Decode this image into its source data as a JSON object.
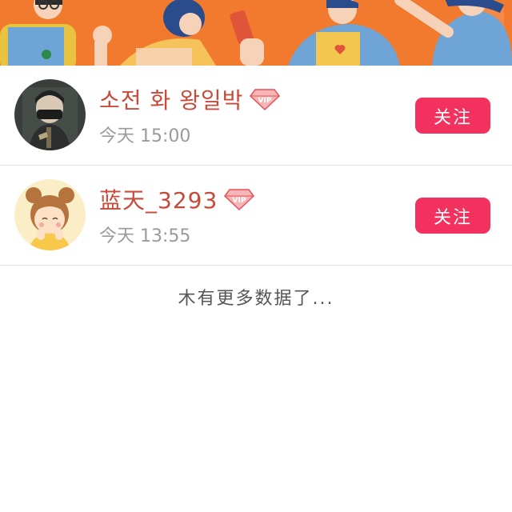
{
  "colors": {
    "banner_bg": "#f27a2e",
    "follow_button": "#f2315e",
    "username": "#c84a3a",
    "time_text": "#9a9a9a",
    "vip_badge": "#e8505b"
  },
  "banner": {
    "image": "cartoon-people-illustration"
  },
  "users": [
    {
      "name": "소전 화 왕일박",
      "vip_icon": "vip-diamond-icon",
      "vip_label": "VIP",
      "time": "今天 15:00",
      "follow_label": "关注",
      "avatar": "avatar-masked-boy"
    },
    {
      "name": "蓝天_3293",
      "vip_icon": "vip-diamond-icon",
      "vip_label": "VIP",
      "time": "今天 13:55",
      "follow_label": "关注",
      "avatar": "avatar-cartoon-girl"
    }
  ],
  "footer": {
    "no_more": "木有更多数据了..."
  }
}
